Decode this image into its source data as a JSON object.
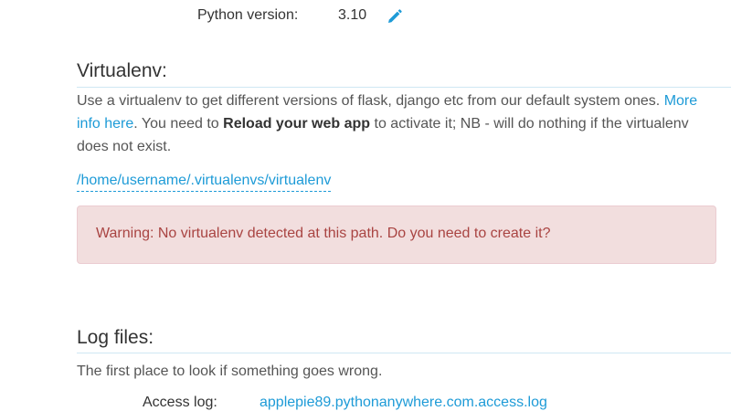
{
  "python": {
    "label": "Python version:",
    "value": "3.10",
    "edit_icon": "pencil-icon"
  },
  "virtualenv": {
    "title": "Virtualenv:",
    "description_1": "Use a virtualenv to get different versions of flask, django etc from our default system ones. ",
    "more_info_link": "More info here",
    "description_2": ". You need to ",
    "reload_text": "Reload your web app",
    "description_3": " to activate it; NB - will do nothing if the virtualenv does not exist.",
    "path": "/home/username/.virtualenvs/virtualenv",
    "warning": "Warning: No virtualenv detected at this path. Do you need to create it?"
  },
  "logs": {
    "title": "Log files:",
    "description": "The first place to look if something goes wrong.",
    "access_label": "Access log:",
    "access_link": "applepie89.pythonanywhere.com.access.log"
  },
  "colors": {
    "link": "#1e9bd7",
    "warning_bg": "#f2dede",
    "warning_text": "#a94442",
    "rule": "#cfe7f3"
  }
}
